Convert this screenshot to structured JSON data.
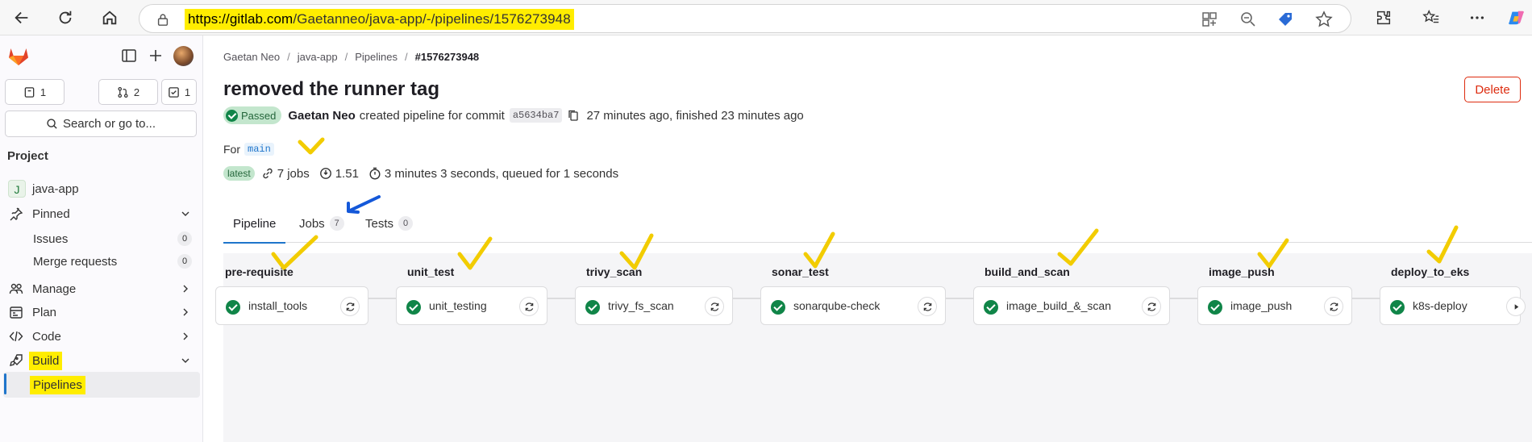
{
  "browser": {
    "url_host": "https://gitlab.com",
    "url_path": "/Gaetanneo/java-app/-/pipelines/1576273948"
  },
  "sidebar": {
    "counters": [
      {
        "icon": "issues-icon",
        "value": "1"
      },
      {
        "icon": "merge-request-icon",
        "value": "2"
      },
      {
        "icon": "todo-icon",
        "value": "1"
      }
    ],
    "search_label": "Search or go to...",
    "heading": "Project",
    "project_name": "java-app",
    "project_initial": "J",
    "pinned_label": "Pinned",
    "issues_label": "Issues",
    "issues_count": "0",
    "mrs_label": "Merge requests",
    "mrs_count": "0",
    "manage_label": "Manage",
    "plan_label": "Plan",
    "code_label": "Code",
    "build_label": "Build",
    "pipelines_label": "Pipelines"
  },
  "breadcrumb": [
    "Gaetan Neo",
    "java-app",
    "Pipelines",
    "#1576273948"
  ],
  "pipeline": {
    "title": "removed the runner tag",
    "delete_label": "Delete",
    "status": "Passed",
    "author": "Gaetan Neo",
    "created_text": "created pipeline for commit",
    "sha": "a5634ba7",
    "time_text": "27 minutes ago, finished 23 minutes ago",
    "for_label": "For",
    "branch": "main",
    "latest_label": "latest",
    "jobs_text": "7 jobs",
    "score": "1.51",
    "duration_text": "3 minutes 3 seconds, queued for 1 seconds"
  },
  "tabs": [
    {
      "label": "Pipeline",
      "count": null
    },
    {
      "label": "Jobs",
      "count": "7"
    },
    {
      "label": "Tests",
      "count": "0"
    }
  ],
  "stages": [
    {
      "name": "pre-requisite",
      "job": "install_tools"
    },
    {
      "name": "unit_test",
      "job": "unit_testing"
    },
    {
      "name": "trivy_scan",
      "job": "trivy_fs_scan"
    },
    {
      "name": "sonar_test",
      "job": "sonarqube-check"
    },
    {
      "name": "build_and_scan",
      "job": "image_build_&_scan"
    },
    {
      "name": "image_push",
      "job": "image_push"
    },
    {
      "name": "deploy_to_eks",
      "job": "k8s-deploy"
    }
  ],
  "colors": {
    "success": "#108548",
    "highlight": "#ffed00",
    "link_blue": "#1f75cb",
    "danger": "#dd2b0e",
    "annotation_yellow": "#f2cc00",
    "annotation_blue": "#1458d9"
  }
}
